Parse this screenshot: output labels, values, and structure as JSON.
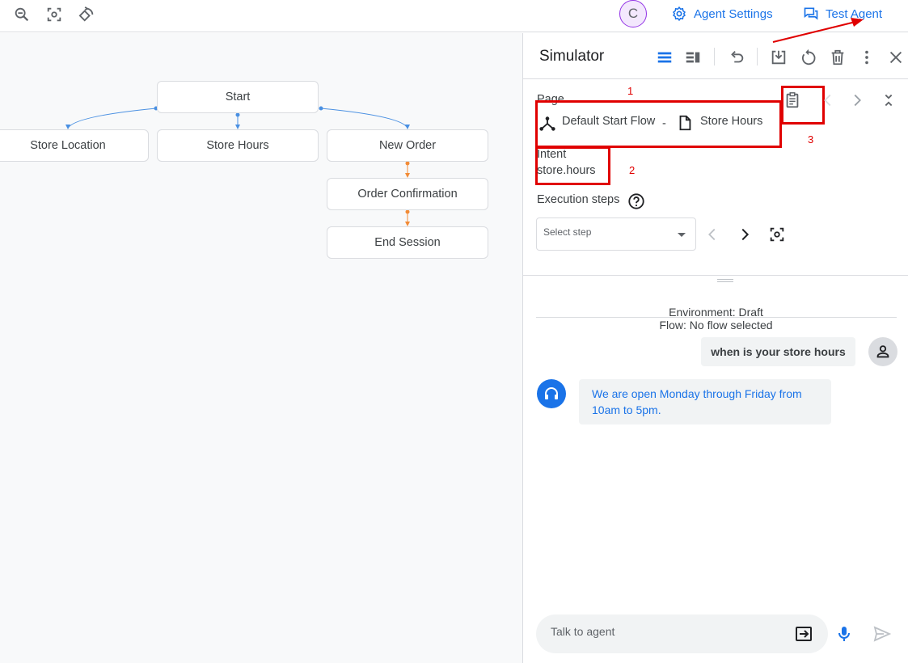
{
  "topbar": {
    "avatar_letter": "C",
    "agent_settings_label": "Agent Settings",
    "test_agent_label": "Test Agent"
  },
  "flow_nodes": {
    "start": "Start",
    "store_location": "Store Location",
    "store_hours": "Store Hours",
    "new_order": "New Order",
    "order_confirmation": "Order Confirmation",
    "end_session": "End Session"
  },
  "simulator": {
    "title": "Simulator",
    "page_label": "Page",
    "flow_name": "Default Start Flow",
    "separator": "-",
    "page_name": "Store Hours",
    "intent_label": "Intent",
    "intent_value": "store.hours",
    "execution_steps_label": "Execution steps",
    "select_step_placeholder": "Select step",
    "environment": "Environment: Draft",
    "flow_status": "Flow: No flow selected",
    "user_message": "when is your store hours",
    "agent_message": "We are open Monday through Friday from 10am to 5pm.",
    "input_placeholder": "Talk to agent"
  },
  "annotations": {
    "n1": "1",
    "n2": "2",
    "n3": "3",
    "color": "#e00000"
  },
  "colors": {
    "accent": "#1a73e8",
    "orange_edge": "#f28b36",
    "blue_edge": "#4a90e2"
  }
}
